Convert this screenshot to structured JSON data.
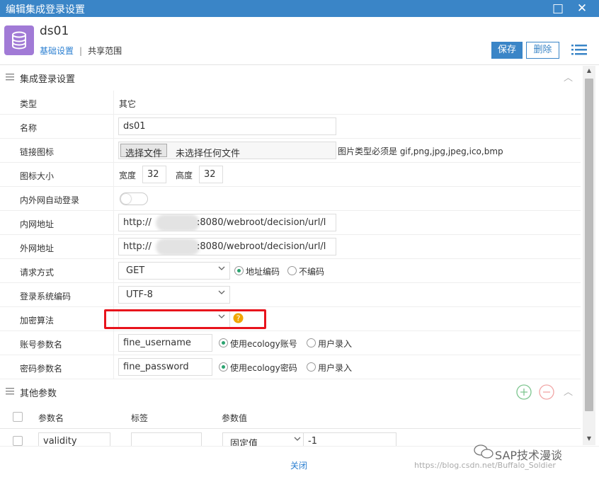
{
  "window": {
    "title": "编辑集成登录设置"
  },
  "header": {
    "title": "ds01",
    "tabs": [
      "基础设置",
      "共享范围"
    ],
    "save": "保存",
    "delete": "删除",
    "accent": "#3a85c7"
  },
  "section1": {
    "title": "集成登录设置"
  },
  "fields": {
    "type": {
      "label": "类型",
      "value": "其它"
    },
    "name": {
      "label": "名称",
      "value": "ds01"
    },
    "icon": {
      "label": "链接图标",
      "choose": "选择文件",
      "none": "未选择任何文件",
      "hint": "图片类型必须是 gif,png,jpg,jpeg,ico,bmp"
    },
    "iconsize": {
      "label": "图标大小",
      "width_label": "宽度",
      "width": "32",
      "height_label": "高度",
      "height": "32"
    },
    "autologin": {
      "label": "内外网自动登录",
      "on": false
    },
    "intranet": {
      "label": "内网地址",
      "prefix": "http://",
      "suffix": ":8080/webroot/decision/url/l"
    },
    "extranet": {
      "label": "外网地址",
      "prefix": "http://",
      "suffix": ":8080/webroot/decision/url/l"
    },
    "method": {
      "label": "请求方式",
      "value": "GET",
      "opt1": "地址编码",
      "opt2": "不编码"
    },
    "encoding": {
      "label": "登录系统编码",
      "value": "UTF-8"
    },
    "encrypt": {
      "label": "加密算法",
      "value": ""
    },
    "account": {
      "label": "账号参数名",
      "value": "fine_username",
      "opt1": "使用ecology账号",
      "opt2": "用户录入"
    },
    "password": {
      "label": "密码参数名",
      "value": "fine_password",
      "opt1": "使用ecology密码",
      "opt2": "用户录入"
    }
  },
  "section2": {
    "title": "其他参数"
  },
  "params": {
    "headers": [
      "参数名",
      "标签",
      "参数值"
    ],
    "row": {
      "name": "validity",
      "label": "",
      "type": "固定值",
      "value": "-1"
    }
  },
  "footer": {
    "close": "关闭"
  },
  "watermark": {
    "brand": "SAP技术漫谈",
    "url": "https://blog.csdn.net/Buffalo_Soldier"
  }
}
